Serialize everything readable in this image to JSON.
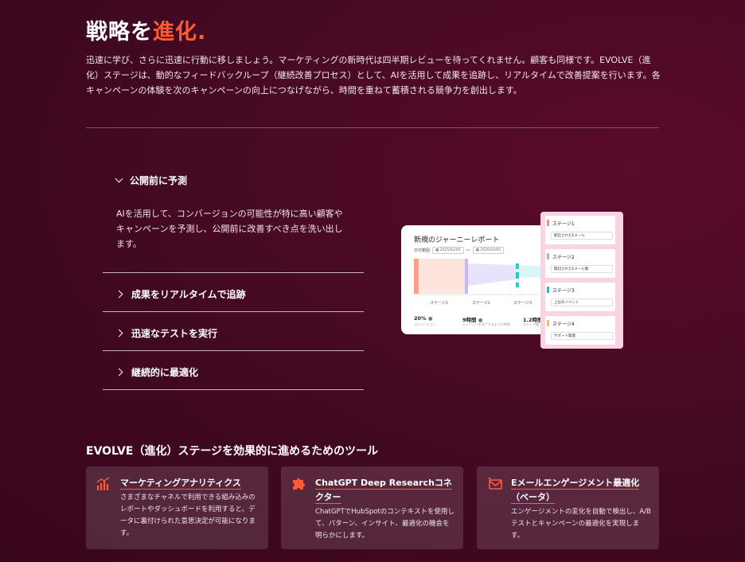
{
  "header": {
    "title_main": "戦略を",
    "title_accent": "進化.",
    "intro": "迅速に学び、さらに迅速に行動に移しましょう。マーケティングの新時代は四半期レビューを待ってくれません。顧客も同様です。EVOLVE（進化）ステージは、動的なフィードバックループ（継続改善プロセス）として、AIを活用して成果を追跡し、リアルタイムで改善提案を行います。各キャンペーンの体験を次のキャンペーンの向上につなげながら、時間を重ねて蓄積される競争力を創出します。"
  },
  "accordion": {
    "open_item": {
      "label": "公開前に予測",
      "body": "AIを活用して、コンバージョンの可能性が特に高い顧客やキャンペーンを予測し、公開前に改善すべき点を洗い出します。"
    },
    "items": [
      {
        "label": "成果をリアルタイムで追跡"
      },
      {
        "label": "迅速なテストを実行"
      },
      {
        "label": "継続的に最適化"
      }
    ]
  },
  "report_card": {
    "title": "新規のジャーニーレポート",
    "date_label": "日付範囲",
    "date_from": "2025/02/05",
    "date_sep": "〜",
    "date_to": "2025/02/05",
    "stage_labels": [
      "ステージ1",
      "ステージ2",
      "ステージ3"
    ],
    "metrics": [
      {
        "value": "20%",
        "label": "コンバージョン"
      },
      {
        "value": "9時間",
        "label": "ジャーニーを完了するまでの時間"
      },
      {
        "value": "1.2時間",
        "label": "ステップ間"
      }
    ]
  },
  "stages_panel": {
    "stages": [
      {
        "name": "ステージ1",
        "value": "配信されたEメール",
        "color": "#ff8a7a"
      },
      {
        "name": "ステージ2",
        "value": "開封されたEメール数",
        "color": "#b9a8f0"
      },
      {
        "name": "ステージ3",
        "value": "上位のイベント",
        "color": "#00c9c3"
      },
      {
        "name": "ステージ4",
        "value": "サポート関連",
        "color": "#f5c060"
      }
    ]
  },
  "tools": {
    "title": "EVOLVE（進化）ステージを効果的に進めるためのツール",
    "cards": [
      {
        "title": "マーケティングアナリティクス",
        "desc": "さまざまなチャネルで利用できる組み込みのレポートやダッシュボードを利用すると、データに裏付けられた意思決定が可能になります。",
        "icon": "bar-chart-icon"
      },
      {
        "title": "ChatGPT Deep Researchコネクター",
        "desc": "ChatGPTでHubSpotのコンテキストを使用して、パターン、インサイト、最適化の機会を明らかにします。",
        "icon": "puzzle-icon"
      },
      {
        "title": "Eメールエンゲージメント最適化（ベータ）",
        "desc": "エンゲージメントの変化を自動で検出し、A/Bテストとキャンペーンの最適化を実現します。",
        "icon": "email-icon"
      }
    ]
  },
  "colors": {
    "accent": "#ff5c35",
    "background": "#3e0820"
  }
}
